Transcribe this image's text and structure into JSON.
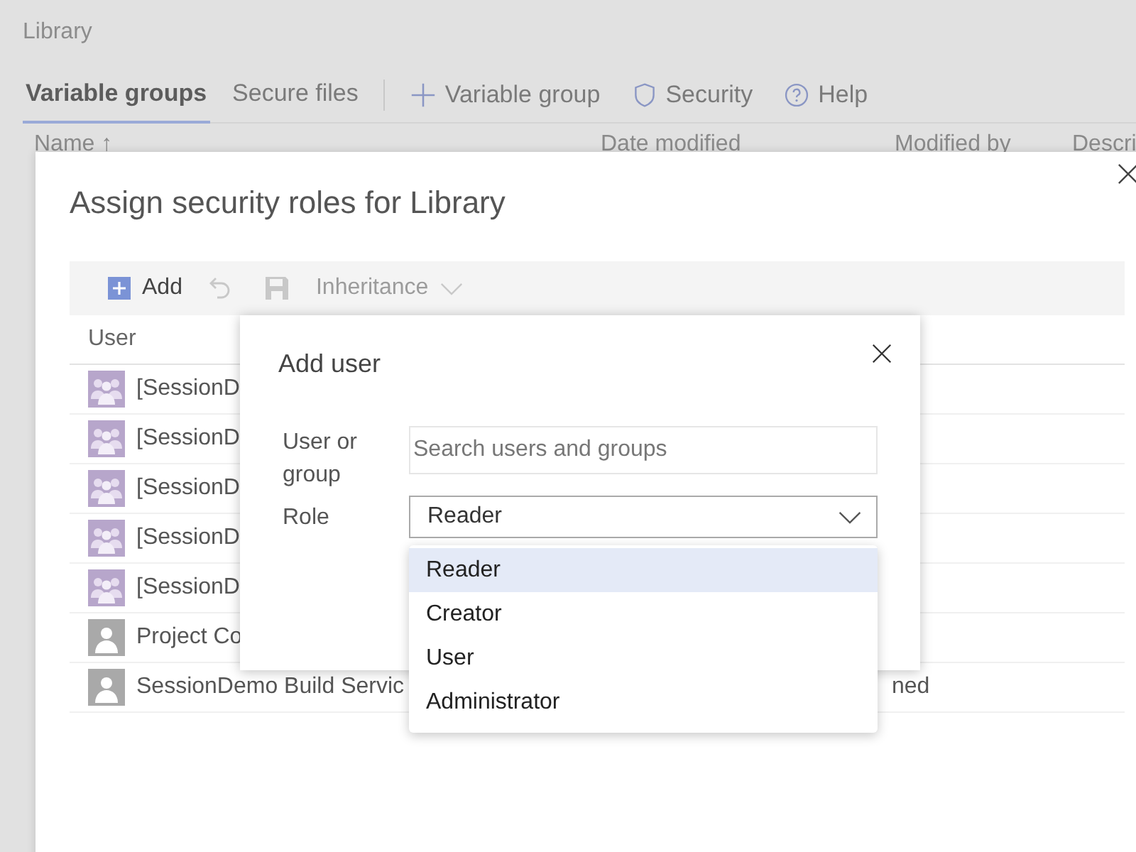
{
  "page": {
    "title": "Library",
    "tabs": [
      {
        "label": "Variable groups",
        "selected": true
      },
      {
        "label": "Secure files",
        "selected": false
      }
    ],
    "actions": [
      {
        "label": "Variable group",
        "kind": "add"
      },
      {
        "label": "Security",
        "kind": "security"
      },
      {
        "label": "Help",
        "kind": "help"
      }
    ],
    "columns": [
      "Name ↑",
      "Date modified",
      "Modified by",
      "Descri"
    ]
  },
  "dialog": {
    "title": "Assign security roles for Library",
    "toolbar": [
      {
        "label": "Add",
        "kind": "add",
        "disabled": false
      },
      {
        "kind": "undo",
        "disabled": true
      },
      {
        "kind": "save",
        "disabled": true
      },
      {
        "label": "Inheritance",
        "kind": "dropdown",
        "disabled": true
      }
    ],
    "column": "User",
    "rows": [
      {
        "name": "[SessionD",
        "kind": "group"
      },
      {
        "name": "[SessionD",
        "kind": "group"
      },
      {
        "name": "[SessionD",
        "kind": "group"
      },
      {
        "name": "[SessionD",
        "kind": "group"
      },
      {
        "name": "[SessionD",
        "kind": "group"
      },
      {
        "name": "Project Co",
        "kind": "user"
      },
      {
        "name": "SessionDemo Build Servic",
        "kind": "user",
        "role": "ned"
      }
    ]
  },
  "add_user": {
    "title": "Add user",
    "user_label": "User or group",
    "search_placeholder": "Search users and groups",
    "role_label": "Role",
    "role_value": "Reader",
    "options": [
      {
        "label": "Reader",
        "selected": true
      },
      {
        "label": "Creator",
        "selected": false
      },
      {
        "label": "User",
        "selected": false
      },
      {
        "label": "Administrator",
        "selected": false
      }
    ]
  }
}
